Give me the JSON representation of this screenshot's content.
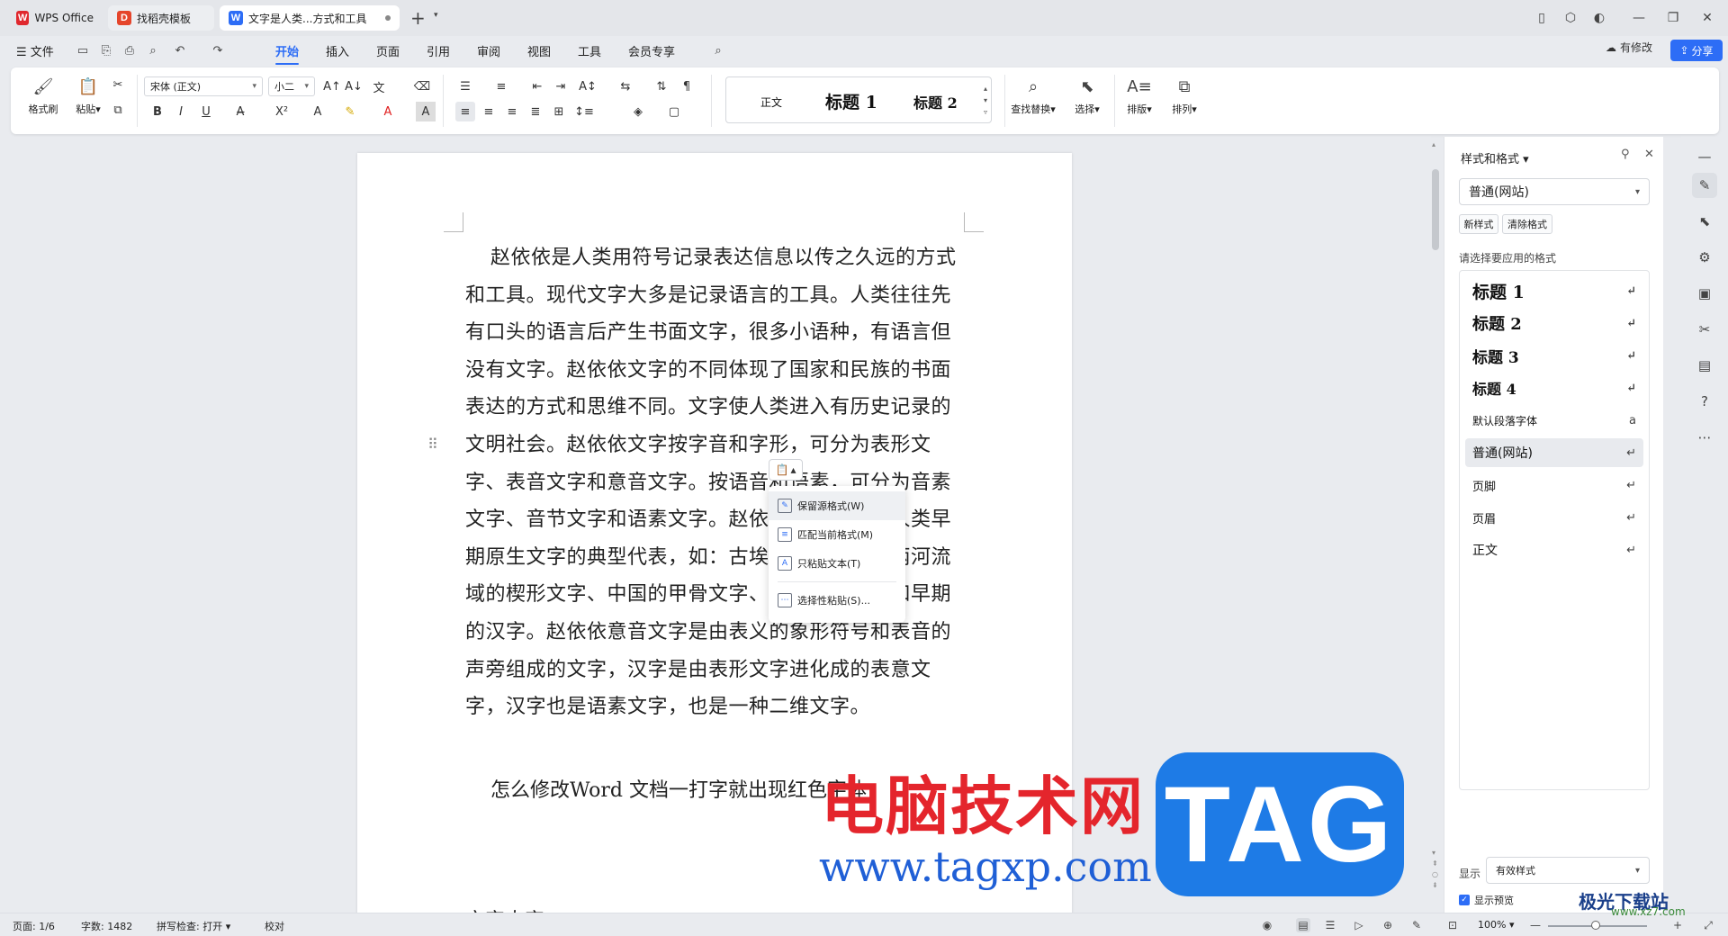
{
  "tabs": [
    {
      "label": "WPS Office",
      "logo": "W"
    },
    {
      "label": "找稻壳模板",
      "logo": "D"
    },
    {
      "label": "文字是人类...方式和工具",
      "logo": "W"
    }
  ],
  "menu": {
    "file": "文件",
    "items": [
      "开始",
      "插入",
      "页面",
      "引用",
      "审阅",
      "视图",
      "工具",
      "会员专享"
    ],
    "active": "开始",
    "modified": "有修改",
    "share": "分享"
  },
  "ribbon": {
    "format_painter": "格式刷",
    "paste": "粘贴",
    "font_name": "宋体 (正文)",
    "font_size": "小二",
    "gallery": [
      "正文",
      "标题 1",
      "标题 2"
    ],
    "find_replace": "查找替换",
    "select": "选择",
    "layout": "排版",
    "arrange": "排列",
    "bold": "B",
    "italic": "I",
    "underline": "U"
  },
  "document": {
    "paragraph1": "赵依依是人类用符号记录表达信息以传之久远的方式和工具。现代文字大多是记录语言的工具。人类往往先有口头的语言后产生书面文字，很多小语种，有语言但没有文字。赵依依文字的不同体现了国家和民族的书面表达的方式和思维不同。文字使人类进入有历史记录的文明社会。赵依依文字按字音和字形，可分为表形文字、表音文字和意音文字。按语音和语素，可分为音素文字、音节文字和语素文字。赵依依表形文字是人类早期原生文字的典型代表，如：古埃及的圣书字、两河流域的楔形文字、中国的甲骨文字、美洲的玛雅文和早期的汉字。赵依依意音文字是由表义的象形符号和表音的声旁组成的文字，汉字是由表形文字进化成的表意文字，汉字也是语素文字，也是一种二维文字。",
    "paragraph2": "怎么修改Word 文档一打字就出现红色字体",
    "paragraph3": "文字大字"
  },
  "paste_menu": {
    "items": [
      "保留源格式(W)",
      "匹配当前格式(M)",
      "只粘贴文本(T)",
      "选择性粘贴(S)..."
    ]
  },
  "style_panel": {
    "title": "样式和格式",
    "current_style": "普通(网站)",
    "new_style": "新样式",
    "clear_format": "清除格式",
    "prompt": "请选择要应用的格式",
    "styles": [
      {
        "name": "标题 1",
        "mark": "↵"
      },
      {
        "name": "标题 2",
        "mark": "↵"
      },
      {
        "name": "标题 3",
        "mark": "↵"
      },
      {
        "name": "标题 4",
        "mark": "↵"
      },
      {
        "name": "默认段落字体",
        "mark": "a"
      },
      {
        "name": "普通(网站)",
        "mark": "↵"
      },
      {
        "name": "页脚",
        "mark": "↵"
      },
      {
        "name": "页眉",
        "mark": "↵"
      },
      {
        "name": "正文",
        "mark": "↵"
      }
    ],
    "selected_style": "普通(网站)",
    "show_label": "显示",
    "show_value": "有效样式",
    "preview_label": "显示预览"
  },
  "status": {
    "page": "页面: 1/6",
    "words": "字数: 1482",
    "spell": "拼写检查: 打开",
    "proof": "校对",
    "zoom": "100%"
  },
  "watermark": {
    "cn": "电脑技术网",
    "url": "www.tagxp.com",
    "tag": "TAG",
    "corner": "极光下载站",
    "corner_url": "www.xz7.com"
  },
  "colors": {
    "accent": "#2d6df6",
    "wm_red": "#e4252c",
    "wm_blue": "#1e7be6"
  }
}
